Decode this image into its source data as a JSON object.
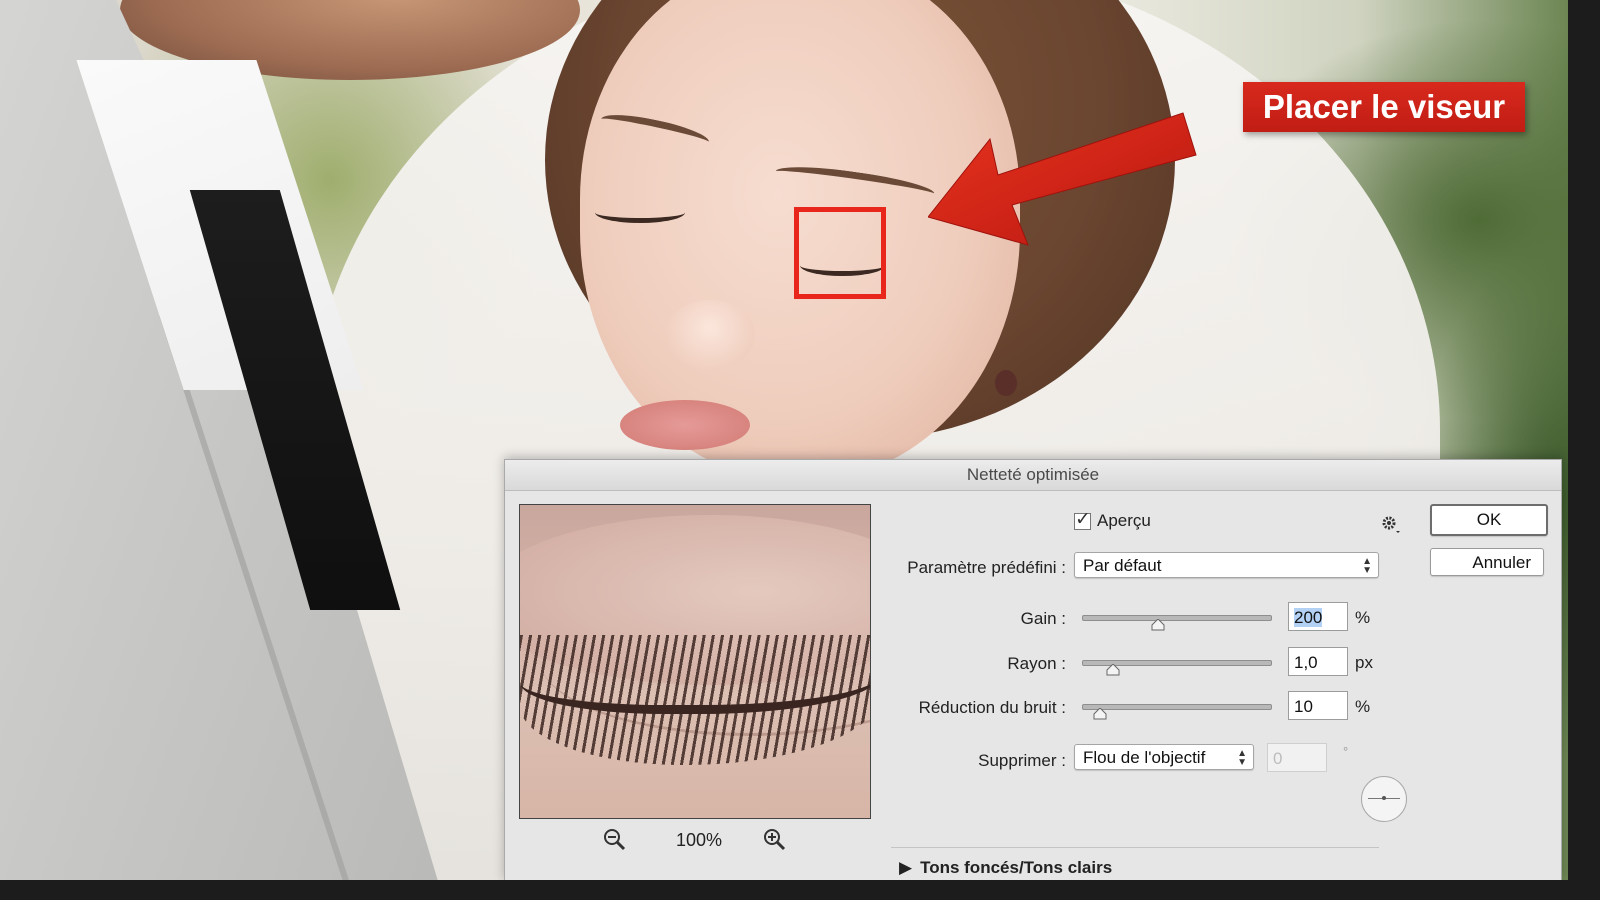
{
  "annotation": {
    "callout_text": "Placer le viseur",
    "accent_color": "#d8291d"
  },
  "dialog": {
    "title": "Netteté optimisée",
    "preview": {
      "zoom_level": "100%",
      "zoom_out_icon": "zoom-out-icon",
      "zoom_in_icon": "zoom-in-icon"
    },
    "apercu": {
      "label": "Aperçu",
      "checked": true
    },
    "settings_icon": "gear-icon",
    "preset": {
      "label": "Paramètre prédéfini :",
      "value": "Par défaut"
    },
    "gain": {
      "label": "Gain :",
      "value": "200",
      "unit": "%",
      "slider_fraction": 0.4
    },
    "rayon": {
      "label": "Rayon :",
      "value": "1,0",
      "unit": "px",
      "slider_fraction": 0.16
    },
    "reduction": {
      "label": "Réduction du bruit :",
      "value": "10",
      "unit": "%",
      "slider_fraction": 0.09
    },
    "supprimer": {
      "label": "Supprimer :",
      "value": "Flou de l'objectif",
      "angle_value": "0",
      "angle_unit": "°"
    },
    "section": {
      "label": "Tons foncés/Tons clairs"
    },
    "buttons": {
      "ok": "OK",
      "cancel": "Annuler"
    }
  }
}
